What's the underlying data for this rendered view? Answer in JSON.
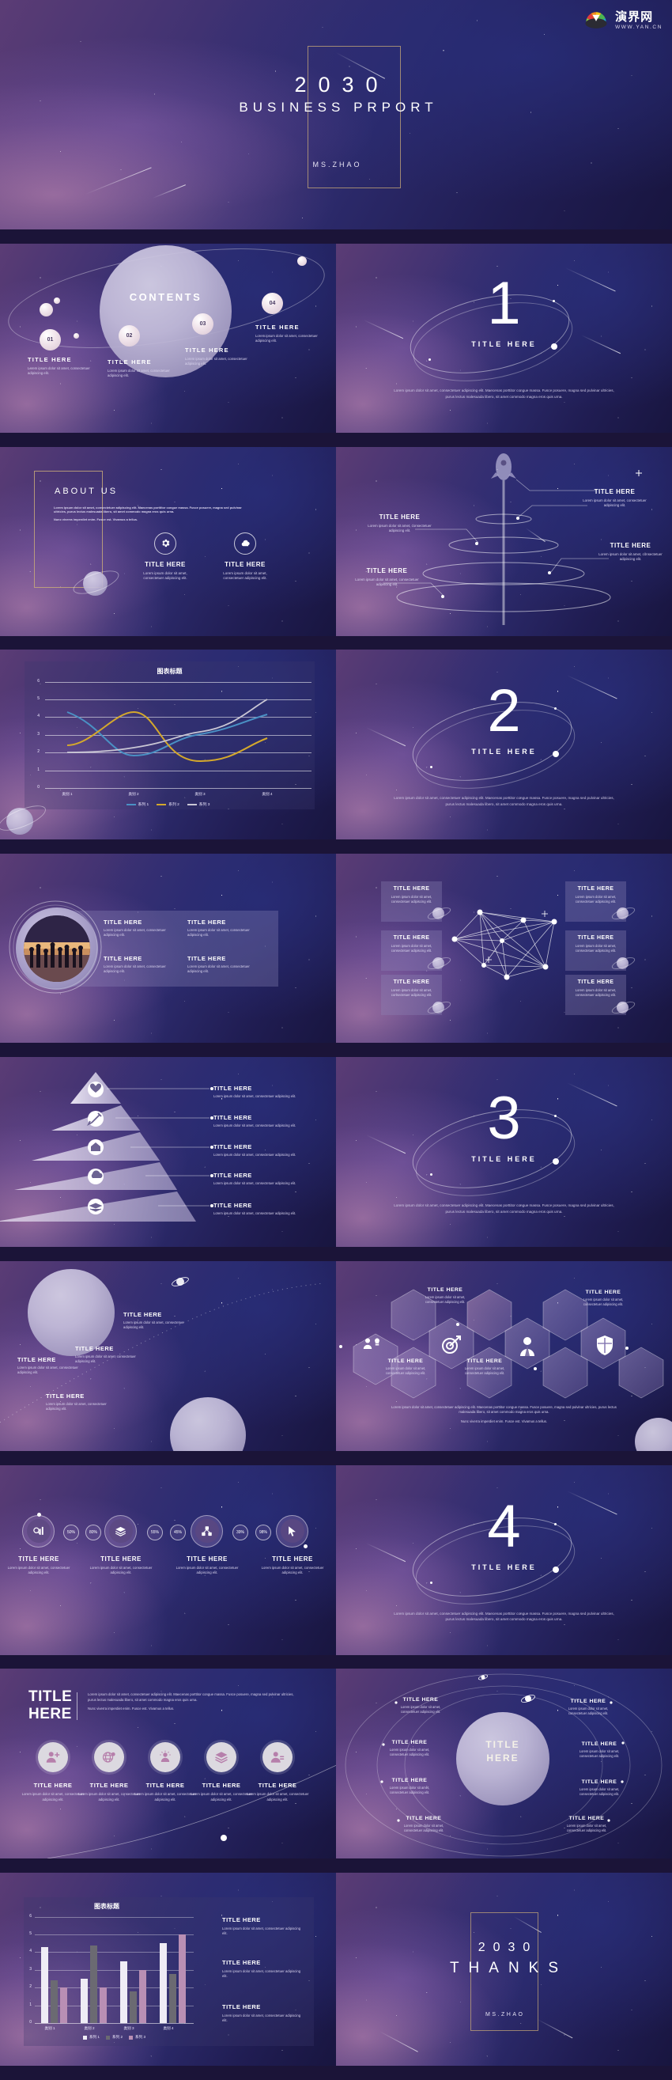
{
  "watermark": {
    "cn": "演界网",
    "en": "WWW.YAN.CN"
  },
  "lorem_short": "Lorem ipsum dolor sit amet, consectetuer adipiscing elit.",
  "lorem_long": "Lorem ipsum dolor sit amet, consectetuer adipiscing elit. Maecenas porttitor congue massa. Fusce posuere, magna sed pulvinar ultricies, purus lectus malesuada libero, sit amet commodo magna eros quis urna.",
  "lorem_tail": "Nunc viverra imperdiet enim. Fusce est. Vivamus a tellus.",
  "title_slide": {
    "year": "2030",
    "subtitle": "BUSINESS PRPORT",
    "author": "MS.ZHAO"
  },
  "contents_slide": {
    "heading": "CONTENTS",
    "items": [
      {
        "num": "01",
        "title": "TITLE HERE",
        "desc": "Lorem ipsum dolor sit amet, consectetuer adipiscing elit."
      },
      {
        "num": "02",
        "title": "TITLE HERE",
        "desc": "Lorem ipsum dolor sit amet, consectetuer adipiscing elit."
      },
      {
        "num": "03",
        "title": "TITLE HERE",
        "desc": "Lorem ipsum dolor sit amet, consectetuer adipiscing elit."
      },
      {
        "num": "04",
        "title": "TITLE HERE",
        "desc": "Lorem ipsum dolor sit amet, consectetuer adipiscing elit."
      }
    ]
  },
  "dividers": [
    {
      "number": "1",
      "label": "TITLE HERE",
      "para": "Lorem ipsum dolor sit amet, consectetuer adipiscing elit. Maecenas porttitor congue massa. Fusce posuere, magna sed pulvinar ultricies, purus lectus malesuada libero, sit amet commodo magna eros quis urna."
    },
    {
      "number": "2",
      "label": "TITLE HERE",
      "para": "Lorem ipsum dolor sit amet, consectetuer adipiscing elit. Maecenas porttitor congue massa. Fusce posuere, magna sed pulvinar ultricies, purus lectus malesuada libero, sit amet commodo magna eros quis urna."
    },
    {
      "number": "3",
      "label": "TITLE HERE",
      "para": "Lorem ipsum dolor sit amet, consectetuer adipiscing elit. Maecenas porttitor congue massa. Fusce posuere, magna sed pulvinar ultricies, purus lectus malesuada libero, sit amet commodo magna eros quis urna."
    },
    {
      "number": "4",
      "label": "TITLE HERE",
      "para": "Lorem ipsum dolor sit amet, consectetuer adipiscing elit. Maecenas porttitor congue massa. Fusce posuere, magna sed pulvinar ultricies, purus lectus malesuada libero, sit amet commodo magna eros quis urna."
    }
  ],
  "about_slide": {
    "heading": "ABOUT US",
    "para1": "Lorem ipsum dolor sit amet, consectetuer adipiscing elit. Maecenas porttitor congue massa. Fusce posuere, magna sed pulvinar ultricies, purus lectus malesuada libero, sit amet commodo magna eros quis urna.",
    "para2": "Nunc viverra imperdiet enim. Fusce est. Vivamus a tellus.",
    "features": [
      {
        "icon": "gear-icon",
        "title": "TITLE HERE",
        "desc": "Lorem ipsum dolor sit amet, consectetuer adipiscing elit."
      },
      {
        "icon": "cloud-icon",
        "title": "TITLE HERE",
        "desc": "Lorem ipsum dolor sit amet, consectetuer adipiscing elit."
      }
    ]
  },
  "rocket_slide": {
    "items": [
      {
        "title": "TITLE HERE",
        "desc": "Lorem ipsum dolor sit amet, consectetuer adipiscing elit."
      },
      {
        "title": "TITLE HERE",
        "desc": "Lorem ipsum dolor sit amet, consectetuer adipiscing elit."
      },
      {
        "title": "TITLE HERE",
        "desc": "Lorem ipsum dolor sit amet, consectetuer adipiscing elit."
      },
      {
        "title": "TITLE HERE",
        "desc": "Lorem ipsum dolor sit amet, consectetuer adipiscing elit."
      }
    ]
  },
  "photo_slide": {
    "cards": [
      {
        "title": "TITLE HERE",
        "desc": "Lorem ipsum dolor sit amet, consectetuer adipiscing elit."
      },
      {
        "title": "TITLE HERE",
        "desc": "Lorem ipsum dolor sit amet, consectetuer adipiscing elit."
      },
      {
        "title": "TITLE HERE",
        "desc": "Lorem ipsum dolor sit amet, consectetuer adipiscing elit."
      },
      {
        "title": "TITLE HERE",
        "desc": "Lorem ipsum dolor sit amet, consectetuer adipiscing elit."
      }
    ]
  },
  "network_slide": {
    "cards": [
      {
        "title": "TITLE HERE",
        "desc": "Lorem ipsum dolor sit amet, consectetuer adipiscing elit."
      },
      {
        "title": "TITLE HERE",
        "desc": "Lorem ipsum dolor sit amet, consectetuer adipiscing elit."
      },
      {
        "title": "TITLE HERE",
        "desc": "Lorem ipsum dolor sit amet, consectetuer adipiscing elit."
      },
      {
        "title": "TITLE HERE",
        "desc": "Lorem ipsum dolor sit amet, consectetuer adipiscing elit."
      },
      {
        "title": "TITLE HERE",
        "desc": "Lorem ipsum dolor sit amet, consectetuer adipiscing elit."
      },
      {
        "title": "TITLE HERE",
        "desc": "Lorem ipsum dolor sit amet, consectetuer adipiscing elit."
      }
    ]
  },
  "pyramid_slide": {
    "rows": [
      {
        "icon": "heart-icon",
        "title": "TITLE HERE",
        "desc": "Lorem ipsum dolor sit amet, consectetuer adipiscing elit."
      },
      {
        "icon": "tools-icon",
        "title": "TITLE HERE",
        "desc": "Lorem ipsum dolor sit amet, consectetuer adipiscing elit."
      },
      {
        "icon": "home-icon",
        "title": "TITLE HERE",
        "desc": "Lorem ipsum dolor sit amet, consectetuer adipiscing elit."
      },
      {
        "icon": "cloud-upload-icon",
        "title": "TITLE HERE",
        "desc": "Lorem ipsum dolor sit amet, consectetuer adipiscing elit."
      },
      {
        "icon": "books-icon",
        "title": "TITLE HERE",
        "desc": "Lorem ipsum dolor sit amet, consectetuer adipiscing elit."
      }
    ]
  },
  "planets_slide": {
    "items": [
      {
        "title": "TITLE HERE",
        "desc": "Lorem ipsum dolor sit amet, consectetuer adipiscing elit."
      },
      {
        "title": "TITLE HERE",
        "desc": "Lorem ipsum dolor sit amet, consectetuer adipiscing elit."
      },
      {
        "title": "TITLE HERE",
        "desc": "Lorem ipsum dolor sit amet, consectetuer adipiscing elit."
      },
      {
        "title": "TITLE HERE",
        "desc": "Lorem ipsum dolor sit amet, consectetuer adipiscing elit."
      }
    ]
  },
  "hex_slide": {
    "cards": [
      {
        "title": "TITLE HERE",
        "desc": "Lorem ipsum dolor sit amet, consectetuer adipiscing elit."
      },
      {
        "title": "TITLE HERE",
        "desc": "Lorem ipsum dolor sit amet, consectetuer adipiscing elit."
      },
      {
        "title": "TITLE HERE",
        "desc": "Lorem ipsum dolor sit amet, consectetuer adipiscing elit."
      },
      {
        "title": "TITLE HERE",
        "desc": "Lorem ipsum dolor sit amet, consectetuer adipiscing elit."
      }
    ],
    "icons": [
      "team-idea-icon",
      "target-arrow-icon",
      "businessman-icon",
      "shield-icon"
    ],
    "para1": "Lorem ipsum dolor sit amet, consectetuer adipiscing elit. Maecenas porttitor congue massa. Fusce posuere, magna sed pulvinar ultricies, purus lectus malesuada libero, sit amet commodo magna eros quis urna.",
    "para2": "Nunc viverra imperdiet enim. Fusce est. Vivamus a tellus."
  },
  "timeline_slide": {
    "percents": [
      "50%",
      "80%",
      "55%",
      "45%",
      "39%",
      "98%"
    ],
    "steps": [
      {
        "icon": "chart-search-icon",
        "title": "TITLE HERE",
        "desc": "Lorem ipsum dolor sit amet, consectetuer adipiscing elit."
      },
      {
        "icon": "layers-icon",
        "title": "TITLE HERE",
        "desc": "Lorem ipsum dolor sit amet, consectetuer adipiscing elit."
      },
      {
        "icon": "network-cubes-icon",
        "title": "TITLE HERE",
        "desc": "Lorem ipsum dolor sit amet, consectetuer adipiscing elit."
      },
      {
        "icon": "cursor-icon",
        "title": "TITLE HERE",
        "desc": "Lorem ipsum dolor sit amet, consectetuer adipiscing elit."
      }
    ]
  },
  "five_icon_slide": {
    "heading_line1": "TITLE",
    "heading_line2": "HERE",
    "para1": "Lorem ipsum dolor sit amet, consectetuer adipiscing elit. Maecenas porttitor congue massa. Fusce posuere, magna sed pulvinar ultricies, purus lectus malesuada libero, sit amet commodo magna eros quis urna.",
    "para2": "Nunc viverra imperdiet enim. Fusce est. Vivamus a tellus.",
    "items": [
      {
        "icon": "add-user-icon",
        "title": "TITLE HERE",
        "desc": "Lorem ipsum dolor sit amet, consectetuer adipiscing elit."
      },
      {
        "icon": "globe-pin-icon",
        "title": "TITLE HERE",
        "desc": "Lorem ipsum dolor sit amet, consectetuer adipiscing elit."
      },
      {
        "icon": "idea-person-icon",
        "title": "TITLE HERE",
        "desc": "Lorem ipsum dolor sit amet, consectetuer adipiscing elit."
      },
      {
        "icon": "layers-icon",
        "title": "TITLE HERE",
        "desc": "Lorem ipsum dolor sit amet, consectetuer adipiscing elit."
      },
      {
        "icon": "user-profile-icon",
        "title": "TITLE HERE",
        "desc": "Lorem ipsum dolor sit amet, consectetuer adipiscing elit."
      }
    ]
  },
  "orbit_slide": {
    "center_line1": "TITLE",
    "center_line2": "HERE",
    "items": [
      {
        "title": "TITLE HERE",
        "desc": "Lorem ipsum dolor sit amet, consectetuer adipiscing elit."
      },
      {
        "title": "TITLE HERE",
        "desc": "Lorem ipsum dolor sit amet, consectetuer adipiscing elit."
      },
      {
        "title": "TITLE HERE",
        "desc": "Lorem ipsum dolor sit amet, consectetuer adipiscing elit."
      },
      {
        "title": "TITLE HERE",
        "desc": "Lorem ipsum dolor sit amet, consectetuer adipiscing elit."
      },
      {
        "title": "TITLE HERE",
        "desc": "Lorem ipsum dolor sit amet, consectetuer adipiscing elit."
      },
      {
        "title": "TITLE HERE",
        "desc": "Lorem ipsum dolor sit amet, consectetuer adipiscing elit."
      },
      {
        "title": "TITLE HERE",
        "desc": "Lorem ipsum dolor sit amet, consectetuer adipiscing elit."
      },
      {
        "title": "TITLE HERE",
        "desc": "Lorem ipsum dolor sit amet, consectetuer adipiscing elit."
      }
    ]
  },
  "bar_slide": {
    "texts": [
      {
        "title": "TITLE HERE",
        "desc": "Lorem ipsum dolor sit amet, consectetuer adipiscing elit."
      },
      {
        "title": "TITLE HERE",
        "desc": "Lorem ipsum dolor sit amet, consectetuer adipiscing elit."
      },
      {
        "title": "TITLE HERE",
        "desc": "Lorem ipsum dolor sit amet, consectetuer adipiscing elit."
      }
    ]
  },
  "thanks_slide": {
    "year": "2030",
    "word": "THANKS",
    "author": "MS.ZHAO"
  },
  "chart_data": [
    {
      "type": "line",
      "title": "图表标题",
      "categories": [
        "类别 1",
        "类别 2",
        "类别 3",
        "类别 4"
      ],
      "series": [
        {
          "name": "系列 1",
          "values": [
            4.3,
            2.5,
            3.5,
            4.5
          ],
          "color": "#4a90c4"
        },
        {
          "name": "系列 2",
          "values": [
            2.4,
            4.4,
            1.8,
            2.8
          ],
          "color": "#d4a82c"
        },
        {
          "name": "系列 3",
          "values": [
            2,
            2,
            3,
            5
          ],
          "color": "#c9c6d4"
        }
      ],
      "ylim": [
        0,
        6
      ],
      "yticks": [
        0,
        1,
        2,
        3,
        4,
        5,
        6
      ],
      "xlabel": "",
      "ylabel": "",
      "grid": true,
      "legend_position": "bottom"
    },
    {
      "type": "bar",
      "title": "图表标题",
      "categories": [
        "类别 1",
        "类别 2",
        "类别 3",
        "类别 4"
      ],
      "series": [
        {
          "name": "系列 1",
          "values": [
            4.3,
            2.5,
            3.5,
            4.5
          ],
          "color": "#efecf5"
        },
        {
          "name": "系列 2",
          "values": [
            2.4,
            4.4,
            1.8,
            2.8
          ],
          "color": "#6b6a72"
        },
        {
          "name": "系列 3",
          "values": [
            2,
            2,
            3,
            5
          ],
          "color": "#b98fb4"
        }
      ],
      "ylim": [
        0,
        6
      ],
      "yticks": [
        0,
        1,
        2,
        3,
        4,
        5,
        6
      ],
      "xlabel": "",
      "ylabel": "",
      "grid": true,
      "legend_position": "bottom"
    }
  ]
}
